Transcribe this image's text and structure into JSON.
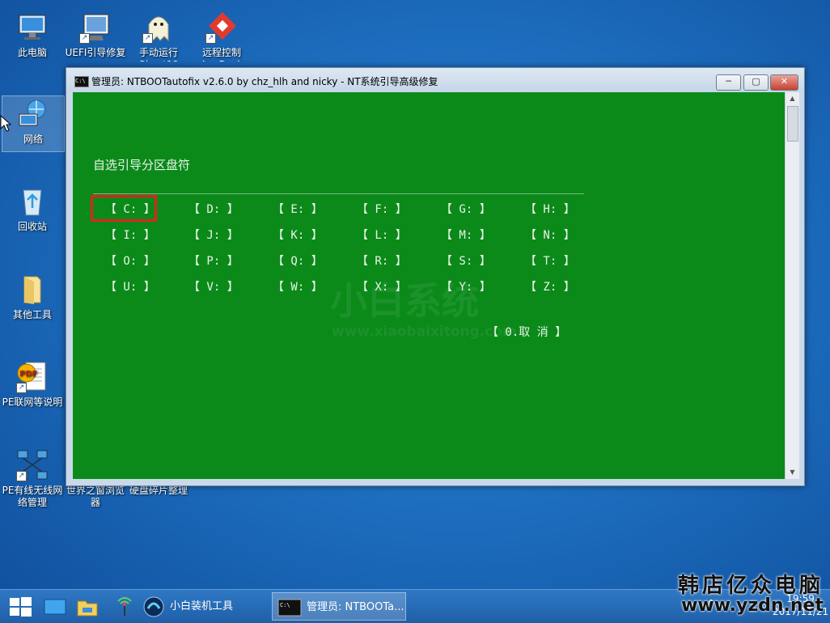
{
  "desktop": {
    "icons": [
      {
        "label": "此电脑"
      },
      {
        "label": "UEFI引导修复"
      },
      {
        "label": "手动运行Ghost12"
      },
      {
        "label": "远程控制AnyDesk"
      },
      {
        "label": "网络"
      },
      {
        "label": "回收站"
      },
      {
        "label": "其他工具"
      },
      {
        "label": "PE联网等说明"
      },
      {
        "label": "PE有线无线网络管理"
      },
      {
        "label": "世界之窗浏览器"
      },
      {
        "label": "硬盘碎片整理"
      }
    ]
  },
  "window": {
    "title": "管理员:  NTBOOTautofix v2.6.0 by chz_hlh and nicky - NT系统引导高级修复",
    "buttons": {
      "minimize": "─",
      "maximize": "▢",
      "close": "✕"
    }
  },
  "console": {
    "heading": "自选引导分区盘符",
    "rule": "____________________________________________________________________________________",
    "drives": [
      [
        "【 C: 】",
        "【 D: 】",
        "【 E: 】",
        "【 F: 】",
        "【 G: 】",
        "【 H: 】"
      ],
      [
        "【 I: 】",
        "【 J: 】",
        "【 K: 】",
        "【 L: 】",
        "【 M: 】",
        "【 N: 】"
      ],
      [
        "【 O: 】",
        "【 P: 】",
        "【 Q: 】",
        "【 R: 】",
        "【 S: 】",
        "【 T: 】"
      ],
      [
        "【 U: 】",
        "【 V: 】",
        "【 W: 】",
        "【 X: 】",
        "【 Y: 】",
        "【 Z: 】"
      ]
    ],
    "cancel": "【 0.取  消 】",
    "watermark_logo": "小白系统",
    "watermark_url": "www.xiaobaixitong.com"
  },
  "taskbar": {
    "app1": "小白装机工具",
    "app2": "管理员: NTBOOTa..."
  },
  "clock": {
    "time": "19:59",
    "date": "2017/11/21"
  },
  "brand": {
    "name": "韩店亿众电脑",
    "url": "www.yzdn.net"
  },
  "colors": {
    "console_bg": "#0b8a1a",
    "highlight": "#e0231e",
    "desktop_bg": "#1e6fc0"
  }
}
